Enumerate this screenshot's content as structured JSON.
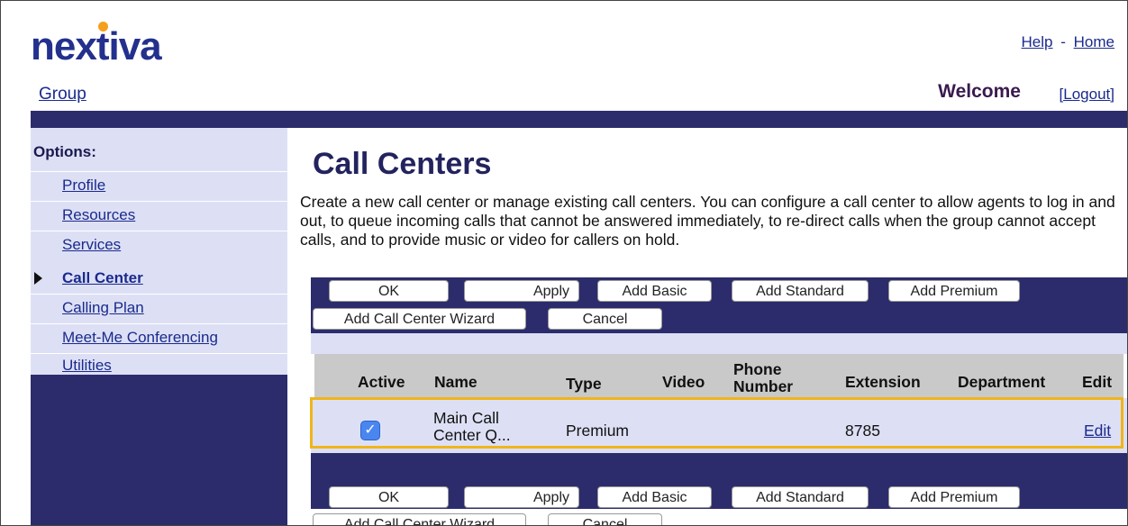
{
  "brand": {
    "logo_text_a": "nex",
    "logo_text_b": "t",
    "logo_text_c": "iva",
    "accent": "#f5a01a",
    "primary": "#23308e",
    "nav": "#2c2c6c"
  },
  "header": {
    "help": "Help",
    "separator": "-",
    "home": "Home",
    "group": "Group",
    "welcome": "Welcome",
    "logout": "[Logout]"
  },
  "sidebar": {
    "title": "Options:",
    "items": [
      {
        "label": "Profile"
      },
      {
        "label": "Resources"
      },
      {
        "label": "Services"
      },
      {
        "label": "Call Center",
        "active": true
      },
      {
        "label": "Calling Plan"
      },
      {
        "label": "Meet-Me Conferencing"
      },
      {
        "label": "Utilities"
      }
    ]
  },
  "main": {
    "title": "Call Centers",
    "description": "Create a new call center or manage existing call centers. You can configure a call center to allow agents to log in and out, to queue incoming calls that cannot be answered immediately, to re-direct calls when the group cannot accept calls, and to provide music or video for callers on hold.",
    "buttons": {
      "ok": "OK",
      "apply": "Apply",
      "add_basic": "Add Basic",
      "add_standard": "Add Standard",
      "add_premium": "Add Premium",
      "wizard": "Add Call Center Wizard",
      "cancel": "Cancel"
    },
    "table": {
      "headers": {
        "active": "Active",
        "name": "Name",
        "type": "Type",
        "video": "Video",
        "phone_a": "Phone",
        "phone_b": "Number",
        "extension": "Extension",
        "department": "Department",
        "edit": "Edit"
      },
      "rows": [
        {
          "active": true,
          "name_a": "Main Call",
          "name_b": "Center Q...",
          "type": "Premium",
          "video": "",
          "phone": "",
          "extension": "8785",
          "department": "",
          "edit": "Edit"
        }
      ]
    }
  }
}
